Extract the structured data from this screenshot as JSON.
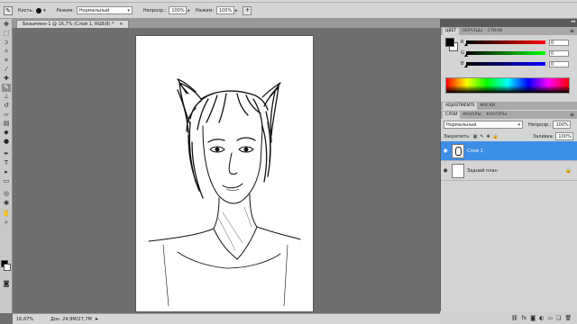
{
  "options_bar": {
    "brush_label": "Кисть:",
    "mode_label": "Режим:",
    "mode_value": "Нормальный",
    "opacity_label": "Непрозр.:",
    "opacity_value": "100%",
    "flow_label": "Нажим:",
    "flow_value": "100%"
  },
  "document": {
    "tab_title": "Безымянн-1 @ 16,7% (Слой 1, RGB/8) *",
    "tab_close": "×"
  },
  "status": {
    "zoom": "16,67%",
    "doc_info": "Док: 24,9М/27,7М",
    "arrow": "▸"
  },
  "color_panel": {
    "tabs": [
      "ЦВЕТ",
      "ОБРАЗЦЫ",
      "СТИЛИ"
    ],
    "channels": [
      {
        "name": "R",
        "value": "0",
        "color_from": "#000000",
        "color_to": "#ff0000"
      },
      {
        "name": "G",
        "value": "0",
        "color_from": "#000000",
        "color_to": "#00ff00"
      },
      {
        "name": "B",
        "value": "0",
        "color_from": "#000000",
        "color_to": "#0000ff"
      }
    ],
    "foreground": "#000000",
    "background": "#ffffff"
  },
  "adjust_panel": {
    "tabs": [
      "ADJUSTMENTS",
      "МАСКИ"
    ]
  },
  "layers_panel": {
    "tabs": [
      "СЛОИ",
      "КАНАЛЫ",
      "КОНТУРЫ"
    ],
    "blend_mode": "Нормальный",
    "opacity_label": "Непрозр.:",
    "opacity_value": "100%",
    "lock_label": "Закрепить:",
    "fill_label": "Заливка:",
    "fill_value": "100%",
    "layers": [
      {
        "name": "Слой 1",
        "active": true
      },
      {
        "name": "Задний план",
        "active": false
      }
    ]
  },
  "colors": {
    "selection": "#3d8ee6",
    "panel_bg": "#d4d4d4",
    "workspace": "#6f6f6f"
  },
  "icons": [
    "brush-icon",
    "eye-icon",
    "lock-icon",
    "panel-menu-icon",
    "airbrush-icon"
  ]
}
